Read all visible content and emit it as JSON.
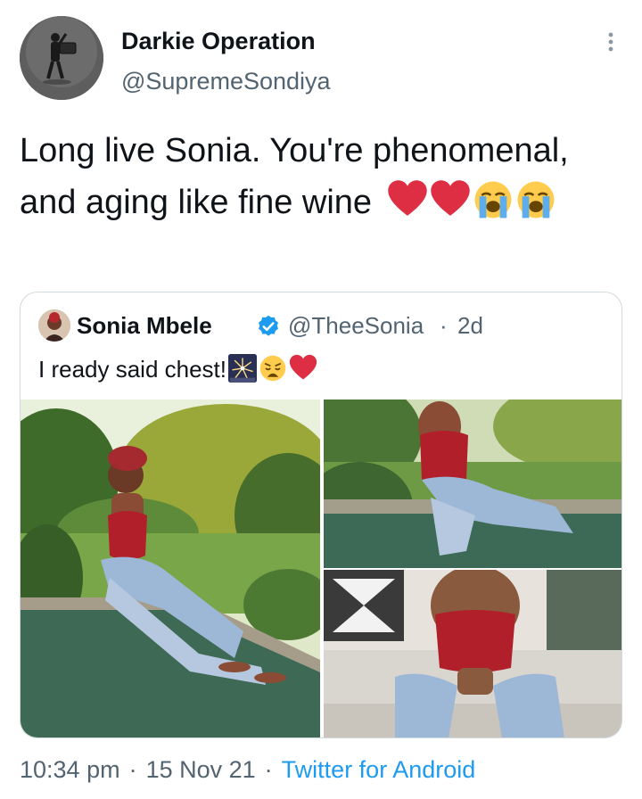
{
  "author": {
    "display_name": "Darkie Operation",
    "handle": "@SupremeSondiya"
  },
  "tweet": {
    "text": "Long live Sonia. You're phenomenal, and aging like fine wine",
    "emojis": [
      "red-heart",
      "red-heart",
      "loudly-crying-face",
      "loudly-crying-face"
    ]
  },
  "quoted_tweet": {
    "display_name": "Sonia Mbele",
    "verified": true,
    "handle": "@TheeSonia",
    "separator": "·",
    "time": "2d",
    "text": "I ready said chest!",
    "emojis": [
      "fireworks",
      "weary-face",
      "red-heart"
    ],
    "media_count": 3
  },
  "footer": {
    "time": "10:34 pm",
    "separator": "·",
    "date": "15 Nov 21",
    "source": "Twitter for Android"
  },
  "colors": {
    "text_primary": "#0f1419",
    "text_secondary": "#536471",
    "link": "#1d9bf0",
    "verified_badge": "#1d9bf0",
    "card_border": "#cfd9de"
  }
}
